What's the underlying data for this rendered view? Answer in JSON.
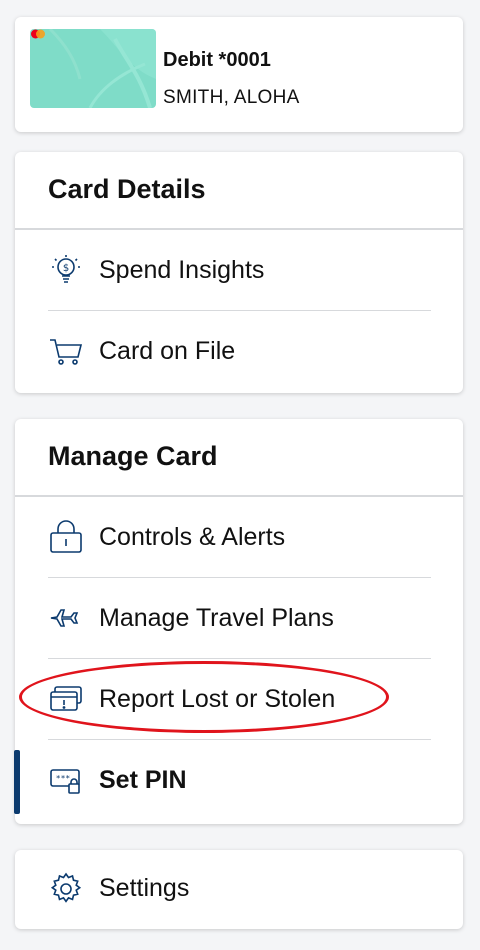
{
  "account": {
    "name": "Debit *0001",
    "holder": "SMITH, ALOHA"
  },
  "card_details": {
    "title": "Card Details",
    "items": [
      {
        "label": "Spend Insights",
        "icon": "lightbulb-dollar-icon"
      },
      {
        "label": "Card on File",
        "icon": "cart-icon"
      }
    ]
  },
  "manage_card": {
    "title": "Manage Card",
    "items": [
      {
        "label": "Controls & Alerts",
        "icon": "lock-icon"
      },
      {
        "label": "Manage Travel Plans",
        "icon": "airplane-icon"
      },
      {
        "label": "Report Lost or Stolen",
        "icon": "card-alert-icon"
      },
      {
        "label": "Set PIN",
        "icon": "pin-lock-icon"
      }
    ]
  },
  "settings": {
    "label": "Settings",
    "icon": "gear-icon"
  },
  "colors": {
    "icon": "#0b3a6e",
    "active_bar": "#0b3a6e",
    "highlight": "#e0141c",
    "card_thumb": "#7fdcc8"
  }
}
